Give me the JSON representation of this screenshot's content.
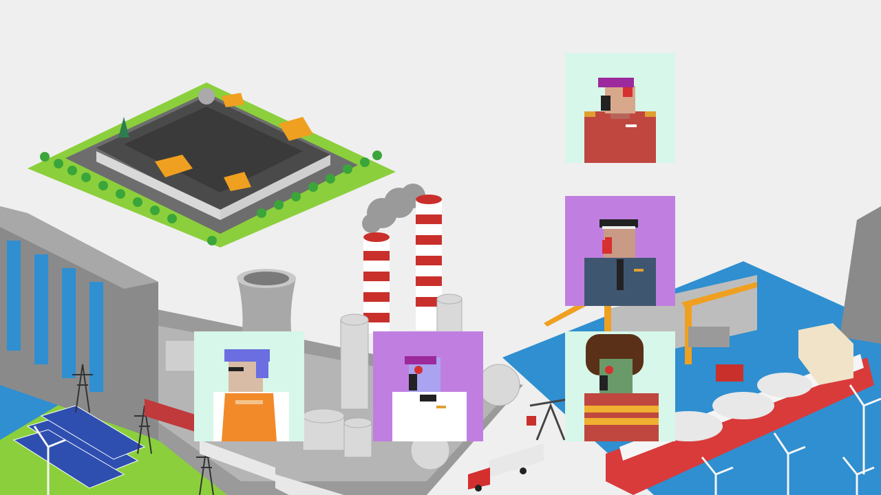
{
  "scene": {
    "colors": {
      "background": "#efefef",
      "water": "#2f8fd0",
      "grass": "#8ccf3c",
      "smokestack_red": "#c9302c",
      "crane": "#f0a020",
      "ship_hull": "#d93b3b"
    },
    "elements": [
      "open-pit-mine",
      "hydro-dam",
      "power-plant-smokestacks",
      "cooling-tower",
      "refinery-tanks",
      "freight-train",
      "power-pylons",
      "solar-panels",
      "offshore-oil-rig",
      "lng-tanker-ship",
      "wind-turbines",
      "fuel-tanker-truck",
      "oil-pump-jack"
    ]
  },
  "avatars": [
    {
      "id": "worker-purple-hair-red-uniform",
      "background": "#d6f7ea"
    },
    {
      "id": "worker-gray-uniform-hat",
      "background": "#c07fe0"
    },
    {
      "id": "worker-blue-hair-orange-vest",
      "background": "#d6f7ea"
    },
    {
      "id": "worker-white-suit-bowtie",
      "background": "#c07fe0"
    },
    {
      "id": "worker-afro-striped-sweater",
      "background": "#d6f7ea"
    }
  ]
}
